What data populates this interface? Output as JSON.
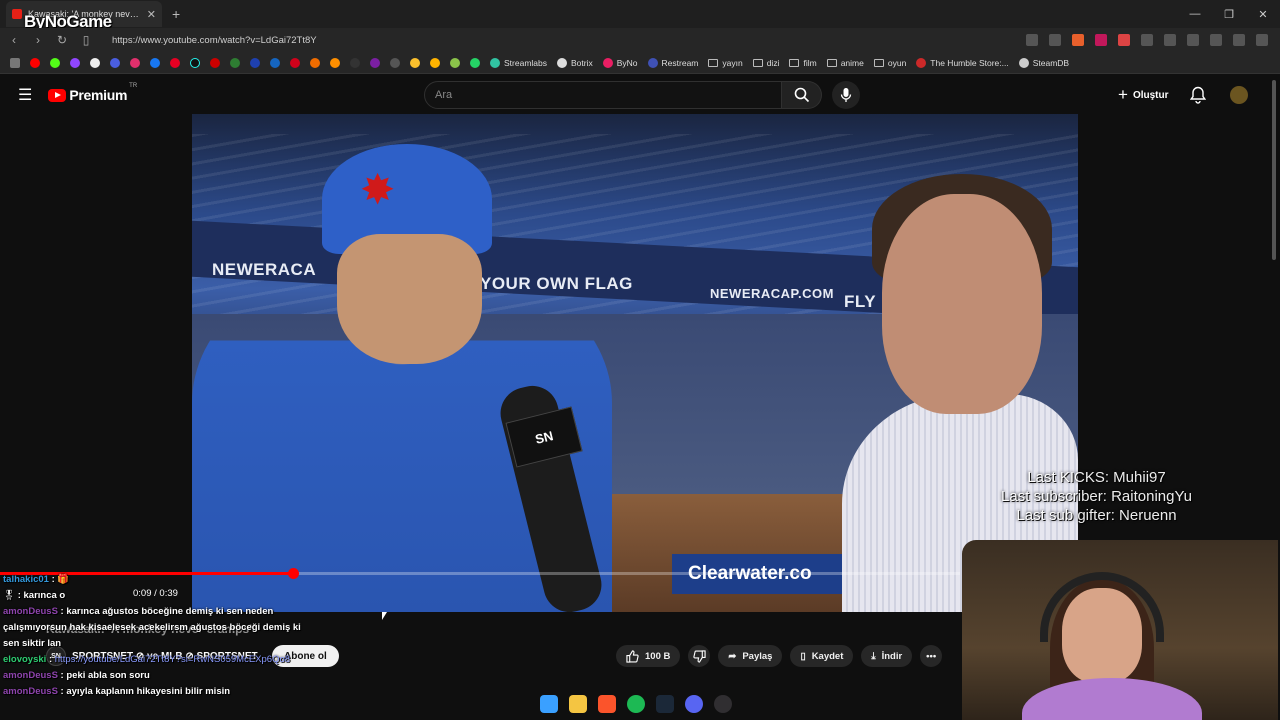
{
  "browser": {
    "tab_title": "Kawasaki: 'A monkey never c...",
    "new_tab": "+",
    "url": "https://www.youtube.com/watch?v=LdGai72Tt8Y",
    "stream_brand": "ByNoGame",
    "window_controls": [
      "—",
      "❐",
      "✕"
    ]
  },
  "bookmarks": [
    {
      "label": "Streamlabs"
    },
    {
      "label": "Botrix"
    },
    {
      "label": "ByNo"
    },
    {
      "label": "Restream"
    },
    {
      "label": "yayın"
    },
    {
      "label": "dizi"
    },
    {
      "label": "film"
    },
    {
      "label": "anime"
    },
    {
      "label": "oyun"
    },
    {
      "label": "The Humble Store:..."
    },
    {
      "label": "SteamDB"
    }
  ],
  "youtube": {
    "logo_text": "Premium",
    "logo_region": "TR",
    "search_placeholder": "Ara",
    "create_label": "Oluştur"
  },
  "video": {
    "banner_texts": [
      "NEWERACA",
      "YOUR OWN FLAG",
      "NEWERACAP.COM",
      "FLY"
    ],
    "bottom_banner": "Clearwater.co",
    "mic_logo": "SN",
    "current_time": "0:09",
    "duration": "0:39",
    "time_display": "0:09 / 0:39",
    "progress_fraction": 0.305,
    "title": "Kawasaki: 'A monkey never cramps'",
    "channel": "SPORTSNET",
    "channel_line": "SPORTSNET ⊘ ve MLB ⊘ SPORTSNET",
    "channel_avatar": "SN",
    "subscribe_label": "Abone ol",
    "like_count": "100 B",
    "share_label": "Paylaş",
    "save_label": "Kaydet",
    "download_label": "İndir",
    "more_label": "•••"
  },
  "stream_overlay": {
    "last_kicks": "Last KICKS: Muhii97",
    "last_subscriber": "Last subscriber: RaitoningYu",
    "last_sub_gifter": "Last sub gifter: Neruenn"
  },
  "chat": [
    {
      "user": "talhakic01",
      "sep": " : ",
      "text": "🎁"
    },
    {
      "user": "",
      "sep": " : ",
      "text": "karınca o"
    },
    {
      "user": "amonDeusS",
      "sep": " : ",
      "text": "karınca ağustos böceğine demiş ki sen neden çalışmıyorsun hak kisaelesek acekelirsm ağustos böceği demiş ki sen siktir lan"
    },
    {
      "user": "elovoyski",
      "sep": " : ",
      "text": "https://youtube/LdGai72Tt8Y?si=RwNS059McEXp6Qo8"
    },
    {
      "user": "amonDeusS",
      "sep": " : ",
      "text": "peki abla son soru"
    },
    {
      "user": "amonDeusS",
      "sep": " : ",
      "text": "ayıyla kaplanın hikayesini bilir misin"
    }
  ],
  "colors": {
    "yt_red": "#ff0000",
    "bg": "#0f0f0f",
    "chat_purple": "#8e44ad",
    "overlay_text": "#ffffff"
  }
}
